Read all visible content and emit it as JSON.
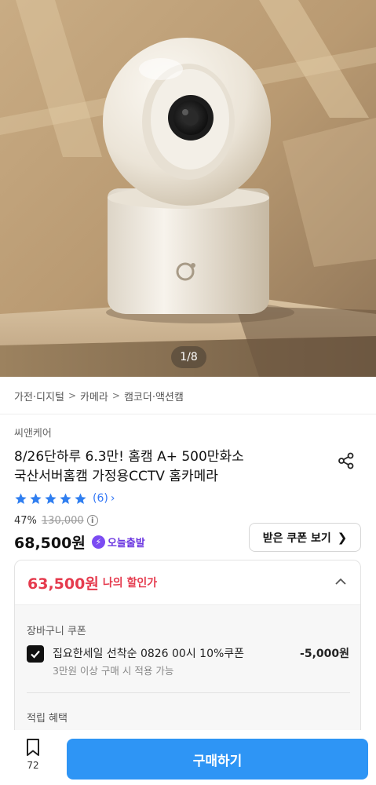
{
  "hero": {
    "image_counter": "1/8"
  },
  "breadcrumb": [
    "가전·디지털",
    "카메라",
    "캠코더·액션캠"
  ],
  "product": {
    "brand": "씨앤케어",
    "title_line1": "8/26단하루 6.3만! 홈캠 A+ 500만화소",
    "title_line2": "국산서버홈캠 가정용CCTV 홈카메라",
    "rating_stars": 5,
    "review_count": "(6)",
    "discount_rate": "47%",
    "original_price": "130,000",
    "price": "68,500원",
    "delivery_badge": "오늘출발",
    "coupon_button": "받은 쿠폰 보기"
  },
  "discount_box": {
    "my_price": "63,500원",
    "my_price_label": "나의 할인가",
    "cart_coupon_title": "장바구니 쿠폰",
    "coupon_name": "집요한세일 선착순 0826 00시 10%쿠폰",
    "coupon_amount": "-5,000원",
    "coupon_condition": "3만원 이상 구매 시 적용 가능",
    "reward_title": "적립 혜택"
  },
  "bottom_bar": {
    "bookmark_count": "72",
    "buy_label": "구매하기"
  },
  "colors": {
    "accent_blue": "#2e95f5",
    "price_red": "#e53b4e",
    "star_blue": "#2f7ef0",
    "badge_purple": "#7b4bf2"
  }
}
